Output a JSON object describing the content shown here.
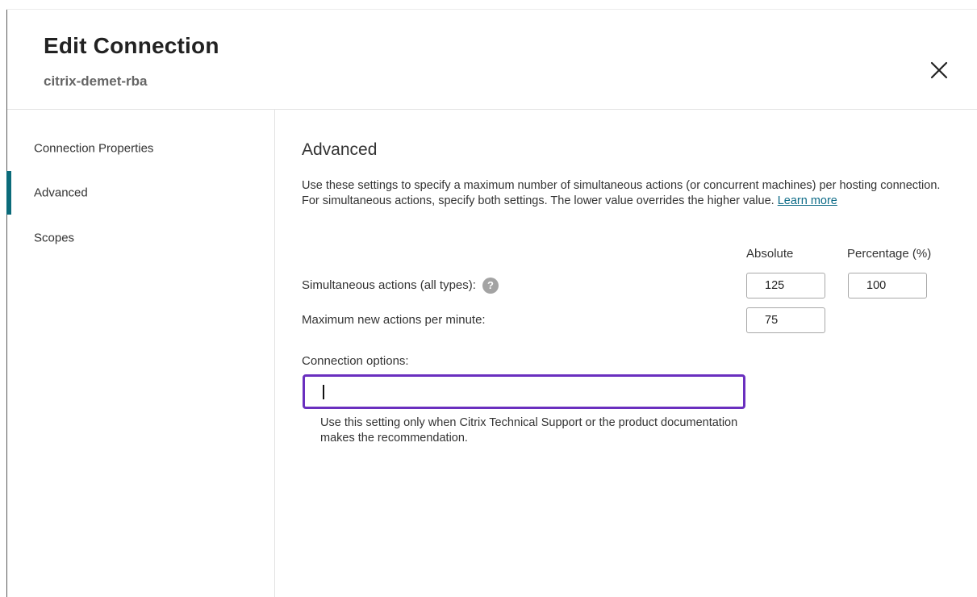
{
  "dialog": {
    "title": "Edit Connection",
    "subtitle": "citrix-demet-rba",
    "close_icon": "close-x-icon"
  },
  "sidebar": {
    "items": [
      {
        "label": "Connection Properties",
        "active": false
      },
      {
        "label": "Advanced",
        "active": true
      },
      {
        "label": "Scopes",
        "active": false
      }
    ],
    "active_color": "#0b6b7a"
  },
  "main": {
    "section_title": "Advanced",
    "description": "Use these settings to specify a maximum number of simultaneous actions (or concurrent machines) per hosting connection. For simultaneous actions, specify both settings. The lower value overrides the higher value.",
    "learn_more": "Learn more",
    "columns": {
      "absolute": "Absolute",
      "percentage": "Percentage (%)"
    },
    "rows": {
      "simultaneous_label": "Simultaneous actions (all types):",
      "simultaneous_help_icon": "question-help-icon",
      "simultaneous_absolute": "125",
      "simultaneous_percentage": "100",
      "per_minute_label": "Maximum new actions per minute:",
      "per_minute_absolute": "75"
    },
    "connection_options": {
      "label": "Connection options:",
      "value": "",
      "hint": "Use this setting only when Citrix Technical Support or the product documentation makes the recommendation.",
      "focus_color": "#6a2fbf"
    }
  }
}
